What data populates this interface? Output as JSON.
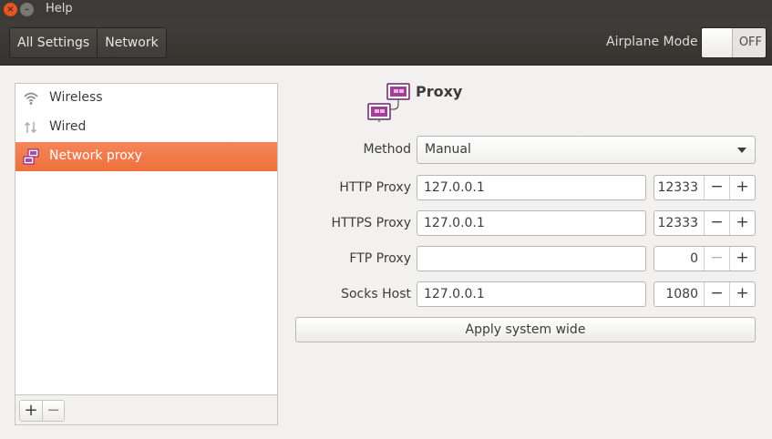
{
  "window": {
    "title": "Help",
    "close_glyph": "×",
    "minimize_glyph": "–"
  },
  "header": {
    "breadcrumbs": [
      "All Settings",
      "Network"
    ],
    "airplane_mode": {
      "label": "Airplane Mode",
      "state": "OFF"
    }
  },
  "sidebar": {
    "items": [
      {
        "label": "Wireless",
        "icon": "wifi-icon",
        "active": false
      },
      {
        "label": "Wired",
        "icon": "wired-icon",
        "active": false
      },
      {
        "label": "Network proxy",
        "icon": "network-proxy-icon",
        "active": true
      }
    ],
    "toolbar": {
      "add": "+",
      "remove": "−"
    }
  },
  "proxy": {
    "title": "Proxy",
    "method": {
      "label": "Method",
      "value": "Manual"
    },
    "rows": [
      {
        "label": "HTTP Proxy",
        "host": "127.0.0.1",
        "port": "12333"
      },
      {
        "label": "HTTPS Proxy",
        "host": "127.0.0.1",
        "port": "12333"
      },
      {
        "label": "FTP Proxy",
        "host": "",
        "port": "0"
      },
      {
        "label": "Socks Host",
        "host": "127.0.0.1",
        "port": "1080"
      }
    ],
    "spin_minus": "−",
    "spin_plus": "+",
    "apply_label": "Apply system wide"
  },
  "colors": {
    "accent": "#ef6f3b",
    "titlebar": "#3c3b37",
    "close_button": "#e95420",
    "icon_purple": "#8c2d84"
  }
}
